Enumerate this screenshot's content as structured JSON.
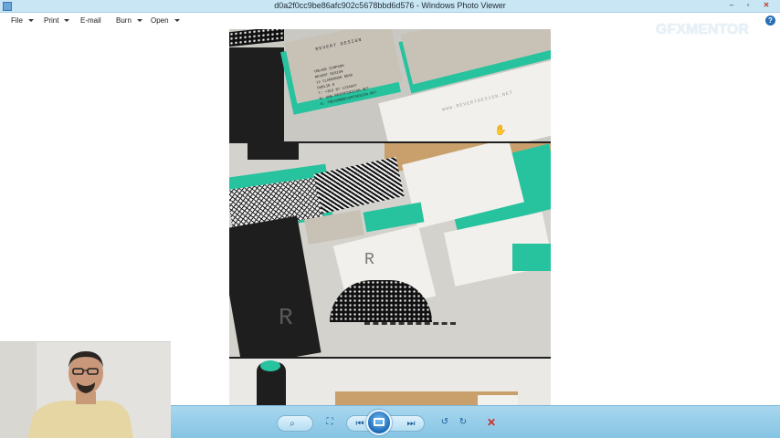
{
  "window": {
    "title": "d0a2f0cc9be86afc902c5678bbd6d576 - Windows Photo Viewer",
    "minimize_glyph": "–",
    "maximize_glyph": "▫",
    "close_glyph": "✕"
  },
  "menu": {
    "items": [
      {
        "label": "File",
        "has_dropdown": true
      },
      {
        "label": "Print",
        "has_dropdown": true
      },
      {
        "label": "E-mail",
        "has_dropdown": false
      },
      {
        "label": "Burn",
        "has_dropdown": true
      },
      {
        "label": "Open",
        "has_dropdown": true
      }
    ],
    "help_glyph": "?"
  },
  "watermark": {
    "text": "GFXMENTOR"
  },
  "photo": {
    "card_brand": "REVERT DESIGN",
    "card_contact": "TREVOR SIMPSON\nREVERT DESIGN\n12 CLARENDON ROAD\nDUBLIN 8\nT: +353 87 1234567\nW: WWW.REVERTDESIGN.NET\nE: TREVOR@REVERTDESIGN.NET",
    "card_url": "WWW.REVERTDESIGN.NET",
    "monogram": "R"
  },
  "toolbar": {
    "zoom_glyph": "⌕",
    "fit_glyph": "⛶",
    "previous_glyph": "⏮",
    "next_glyph": "⏭",
    "rotate_ccw_glyph": "↺",
    "rotate_cw_glyph": "↻",
    "delete_glyph": "✕"
  },
  "colors": {
    "titlebar": "#c9e6f5",
    "toolbar": "#9dd2ec",
    "accent_teal": "#27c29e",
    "delete_red": "#d12a2a"
  }
}
